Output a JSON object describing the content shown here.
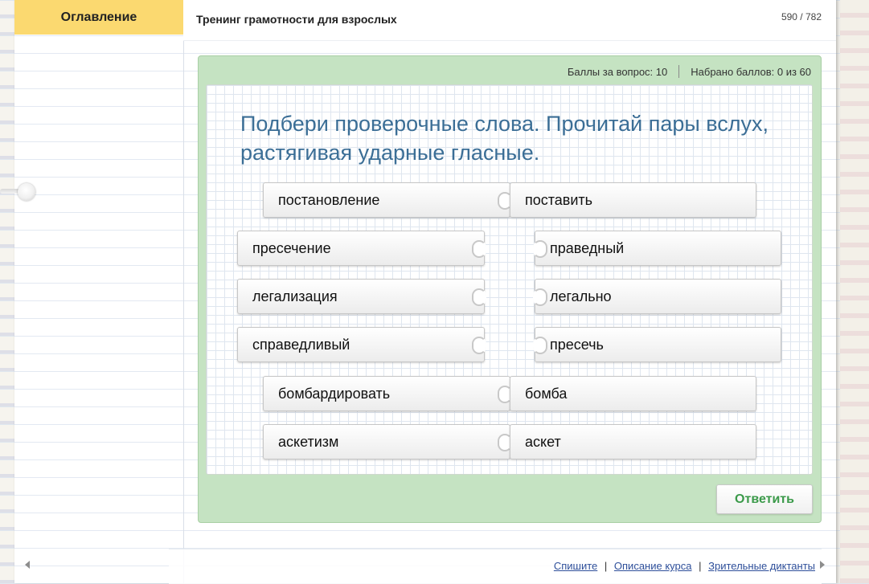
{
  "sidebar": {
    "title": "Оглавление"
  },
  "header": {
    "course_title": "Тренинг грамотности для взрослых",
    "page_counter": "590 / 782"
  },
  "score": {
    "points_per_question": "Баллы за вопрос: 10",
    "total_points": "Набрано баллов: 0 из 60"
  },
  "task": {
    "question": "Подбери проверочные слова. Прочитай пары вслух, растягивая ударные гласные."
  },
  "puzzle": {
    "left": [
      "постановление",
      "пресечение",
      "легализация",
      "справедливый",
      "бомбардировать",
      "аскетизм"
    ],
    "right": [
      "поставить",
      "праведный",
      "легально",
      "пресечь",
      "бомба",
      "аскет"
    ]
  },
  "actions": {
    "answer_label": "Ответить"
  },
  "footer": {
    "link1": "Спишите",
    "link2": "Описание курса",
    "link3": "Зрительные диктанты",
    "separator": "|"
  },
  "colors": {
    "sidebar_header": "#fbd970",
    "task_frame": "#c5e3c2",
    "question_text": "#3b6e96",
    "answer_button_text": "#3b9a4a",
    "link": "#2e4f9a"
  }
}
